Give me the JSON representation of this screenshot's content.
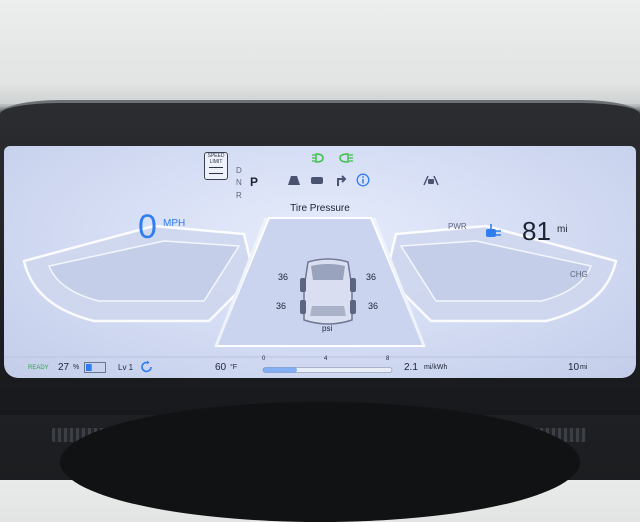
{
  "speed_limit": {
    "line1": "SPEED",
    "line2": "LIMIT"
  },
  "gear": {
    "d": "D",
    "n": "N",
    "p": "P",
    "r": "R",
    "selected": "P"
  },
  "speed": {
    "value": "0",
    "unit": "MPH"
  },
  "range": {
    "value": "81",
    "unit": "mi"
  },
  "gauge_labels": {
    "pwr": "PWR",
    "chg": "CHG"
  },
  "center": {
    "title": "Tire Pressure",
    "front_left": "36",
    "front_right": "36",
    "rear_left": "36",
    "rear_right": "36",
    "unit": "psi"
  },
  "bottom": {
    "status": "READY",
    "battery_pct": "27",
    "battery_unit": "%",
    "regen_level": "Lv 1",
    "temp": "60",
    "temp_unit": "°F",
    "efficiency_scale": [
      "0",
      "4",
      "8"
    ],
    "efficiency_value": "2.1",
    "efficiency_unit": "mi/kWh",
    "trip": "10",
    "trip_unit": "mi"
  },
  "colors": {
    "accent_blue": "#2f7df0",
    "indicator_green": "#3cbf4a",
    "ready_green": "#2da84a"
  },
  "icons": [
    "speed-limit-icon",
    "headlight-icon",
    "forward-collision-icon",
    "lane-keeping-icon",
    "smart-cruise-icon",
    "nav-turn-icon",
    "info-icon",
    "lane-follow-icon",
    "ev-plug-icon",
    "regen-icon",
    "battery-icon"
  ]
}
